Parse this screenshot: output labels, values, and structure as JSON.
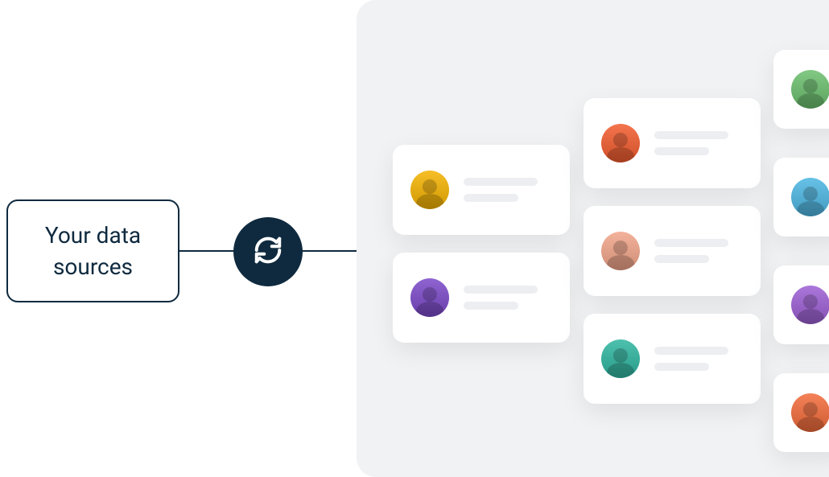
{
  "source": {
    "label": "Your data sources"
  },
  "sync": {
    "icon_name": "sync-icon"
  },
  "colors": {
    "primary_dark": "#0f2a3f",
    "panel_bg": "#f1f2f4",
    "skeleton_line": "#eceef1"
  },
  "cards": [
    {
      "id": "c1",
      "avatar_color": "av-yellow",
      "avatar_name": "person-avatar-1"
    },
    {
      "id": "c2",
      "avatar_color": "av-purple",
      "avatar_name": "person-avatar-2"
    },
    {
      "id": "c3",
      "avatar_color": "av-orange",
      "avatar_name": "person-avatar-3"
    },
    {
      "id": "c4",
      "avatar_color": "av-peach",
      "avatar_name": "person-avatar-4"
    },
    {
      "id": "c5",
      "avatar_color": "av-teal",
      "avatar_name": "person-avatar-5"
    },
    {
      "id": "c6",
      "avatar_color": "av-green",
      "avatar_name": "person-avatar-6",
      "partial": true
    },
    {
      "id": "c7",
      "avatar_color": "av-cyan",
      "avatar_name": "person-avatar-7",
      "partial": true
    },
    {
      "id": "c8",
      "avatar_color": "av-violet",
      "avatar_name": "person-avatar-8",
      "partial": true
    },
    {
      "id": "c9",
      "avatar_color": "av-coral",
      "avatar_name": "person-avatar-9",
      "partial": true
    }
  ]
}
